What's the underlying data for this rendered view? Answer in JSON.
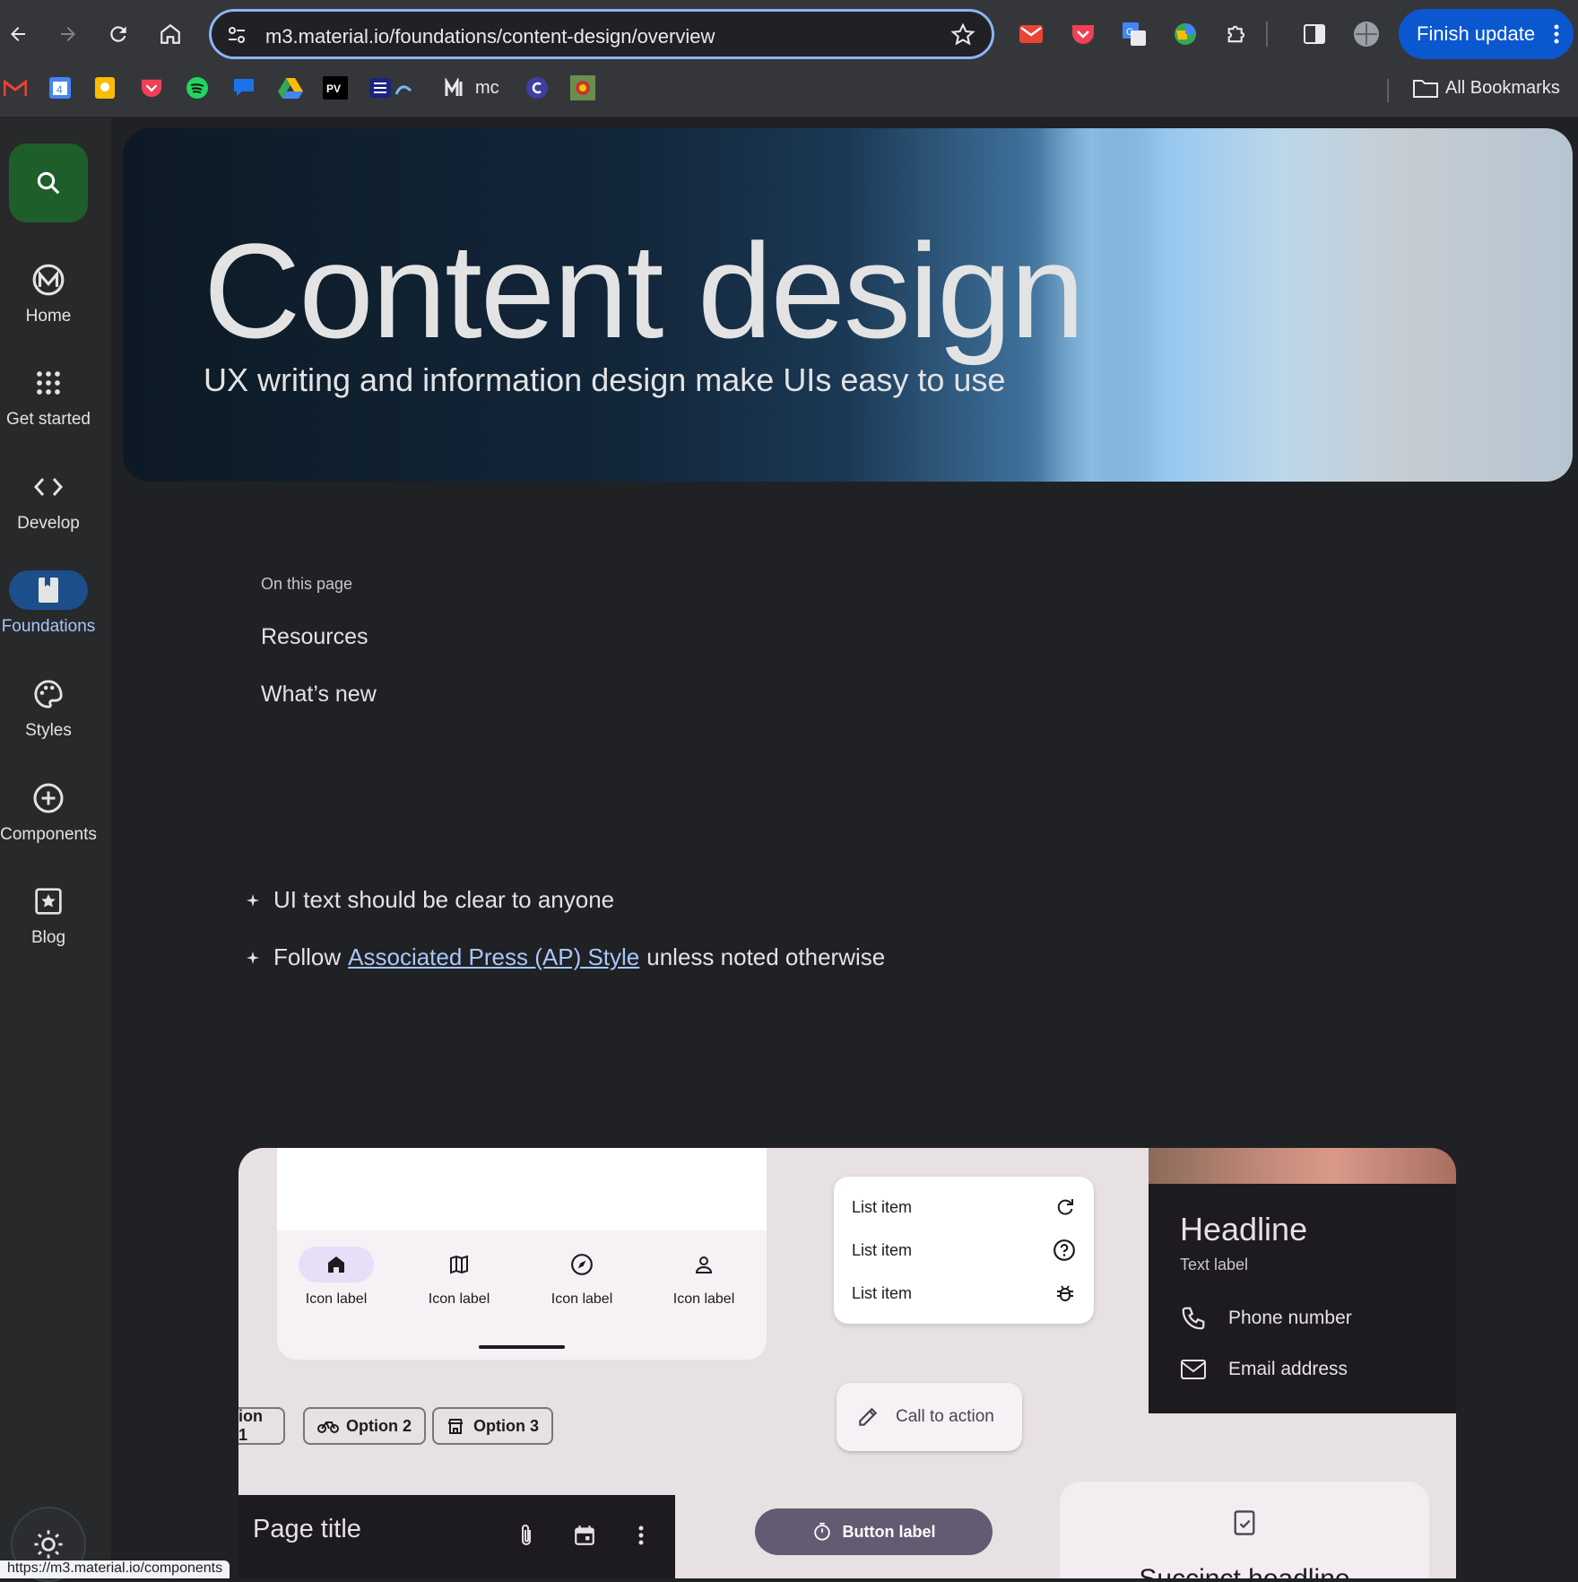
{
  "browser": {
    "url": "m3.material.io/foundations/content-design/overview",
    "finish_update": "Finish update",
    "bookmarks": {
      "mc_label": "mc",
      "all_bookmarks": "All Bookmarks"
    },
    "status_url": "https://m3.material.io/components"
  },
  "rail": {
    "items": [
      {
        "label": "Home"
      },
      {
        "label": "Get started"
      },
      {
        "label": "Develop"
      },
      {
        "label": "Foundations"
      },
      {
        "label": "Styles"
      },
      {
        "label": "Components"
      },
      {
        "label": "Blog"
      }
    ],
    "active": "Foundations"
  },
  "hero": {
    "title": "Content design",
    "subtitle": "UX writing and information design make UIs easy to use"
  },
  "toc": {
    "heading": "On this page",
    "links": [
      "Resources",
      "What’s new"
    ]
  },
  "bullets": {
    "first": "UI text should be clear to anyone",
    "second_prefix": "Follow",
    "second_link": "Associated Press (AP) Style",
    "second_suffix": "unless noted otherwise"
  },
  "showcase": {
    "nav_bar": {
      "labels": [
        "Icon label",
        "Icon label",
        "Icon label",
        "Icon label"
      ]
    },
    "list": {
      "items": [
        "List item",
        "List item",
        "List item"
      ]
    },
    "contact": {
      "headline": "Headline",
      "text_label": "Text label",
      "phone": "Phone number",
      "email": "Email address"
    },
    "chips": [
      "ion 1",
      "Option 2",
      "Option 3"
    ],
    "cta": "Call to action",
    "top_app_bar": {
      "title": "Page title"
    },
    "button_label": "Button label",
    "card": {
      "headline": "Succinct headline"
    }
  },
  "colors": {
    "accent_blue": "#8ab4f8",
    "finish_button": "#0b57d0",
    "fab_green": "#1e5e2b",
    "rail_active": "#1b4e8a",
    "link": "#a8c7fa"
  }
}
